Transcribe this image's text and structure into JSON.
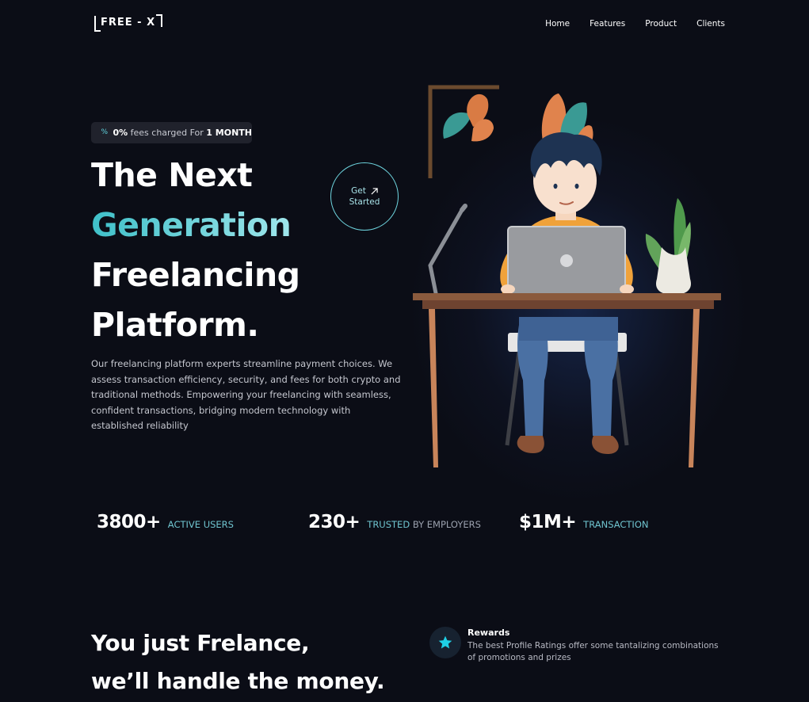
{
  "brand": {
    "logo_text": "FREE - X"
  },
  "nav": {
    "items": [
      "Home",
      "Features",
      "Product",
      "Clients"
    ]
  },
  "hero": {
    "badge": {
      "pct": "0%",
      "text": " fees charged For ",
      "period": "1 MONTH"
    },
    "headline": {
      "line1": "The Next",
      "line2": "Generation",
      "line3": "Freelancing",
      "line4": "Platform."
    },
    "description": "Our freelancing platform experts streamline payment choices. We assess transaction efficiency, security, and fees for both crypto and traditional methods. Empowering your freelancing with seamless, confident transactions, bridging modern technology with established reliability",
    "cta": {
      "line1": "Get",
      "line2": "Started",
      "arrow_icon": "arrow-up-right-icon"
    },
    "accent_color": "#5fd3de"
  },
  "stats": [
    {
      "number": "3800+",
      "label": "ACTIVE USERS"
    },
    {
      "number": "230+",
      "label_accent": "TRUSTED",
      "label_rest": " BY EMPLOYERS"
    },
    {
      "number": "$1M+",
      "label": "TRANSACTION"
    }
  ],
  "section2": {
    "heading_line1": "You just Frelance,",
    "heading_line2": "we’ll handle the money.",
    "feature": {
      "icon": "star-icon",
      "title": "Rewards",
      "text": "The best Profile Ratings offer some tantalizing combinations of promotions and prizes"
    }
  }
}
